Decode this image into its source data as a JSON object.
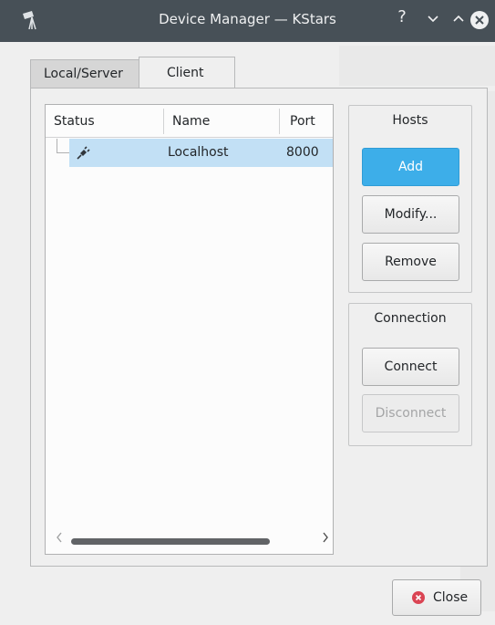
{
  "window": {
    "title": "Device Manager — KStars",
    "help_glyph": "?"
  },
  "tabs": [
    {
      "label": "Local/Server",
      "active": false
    },
    {
      "label": "Client",
      "active": true
    }
  ],
  "table": {
    "columns": [
      "Status",
      "Name",
      "Port"
    ],
    "rows": [
      {
        "status_icon": "plug-icon",
        "name": "Localhost",
        "port": "8000",
        "selected": true
      }
    ]
  },
  "hosts_group": {
    "title": "Hosts",
    "add_label": "Add",
    "modify_label": "Modify...",
    "remove_label": "Remove"
  },
  "connection_group": {
    "title": "Connection",
    "connect_label": "Connect",
    "disconnect_label": "Disconnect",
    "disconnect_enabled": false
  },
  "footer": {
    "close_label": "Close"
  },
  "colors": {
    "accent": "#3daee9",
    "selection": "#c2e0f5",
    "titlebar": "#475057",
    "close_icon": "#da4453"
  }
}
